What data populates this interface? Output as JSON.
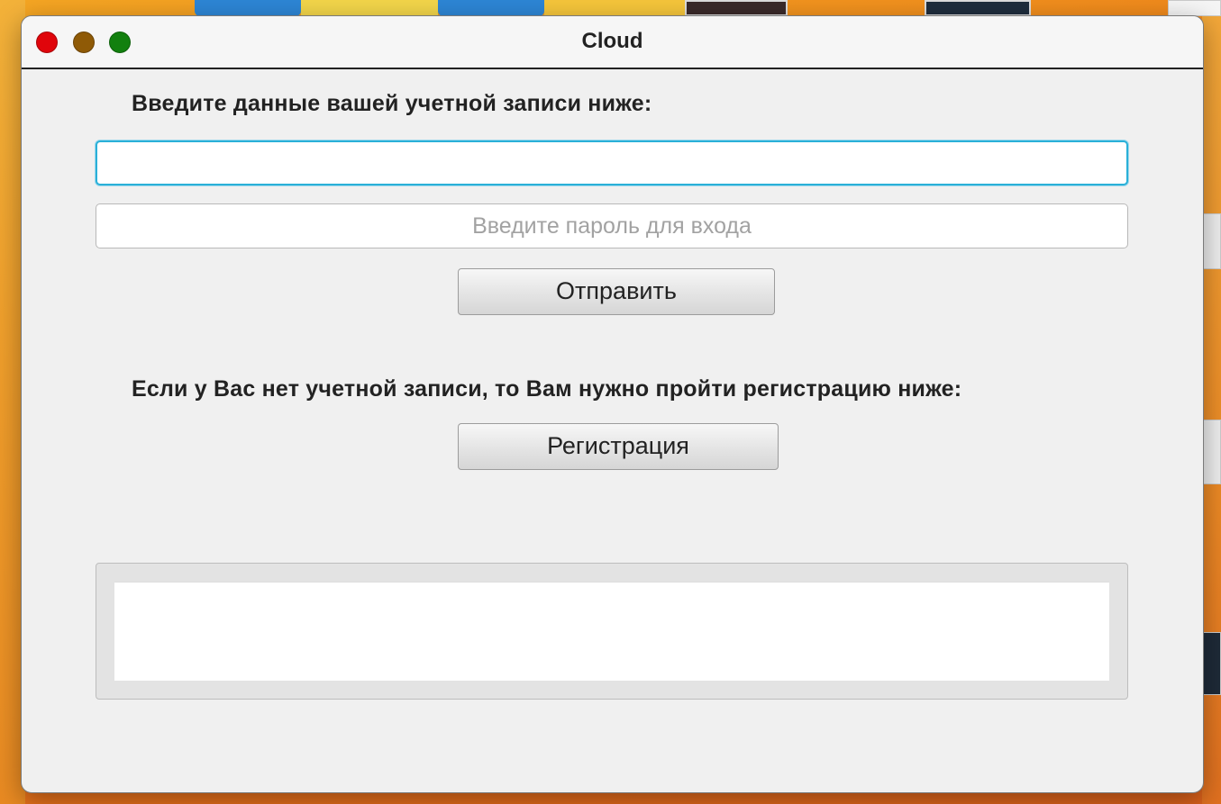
{
  "window": {
    "title": "Cloud"
  },
  "login": {
    "heading": "Введите данные вашей учетной записи ниже:",
    "login_value": "",
    "password_placeholder": "Введите пароль для входа",
    "submit_label": "Отправить"
  },
  "register": {
    "heading": "Если у Вас нет учетной записи, то Вам нужно пройти регистрацию ниже:",
    "button_label": "Регистрация"
  },
  "output": {
    "text": ""
  },
  "colors": {
    "close": "#e0050b",
    "minimize": "#8f5a06",
    "maximize": "#12800e",
    "focus_ring": "#2ab0d8",
    "window_bg": "#f0f0f0"
  }
}
